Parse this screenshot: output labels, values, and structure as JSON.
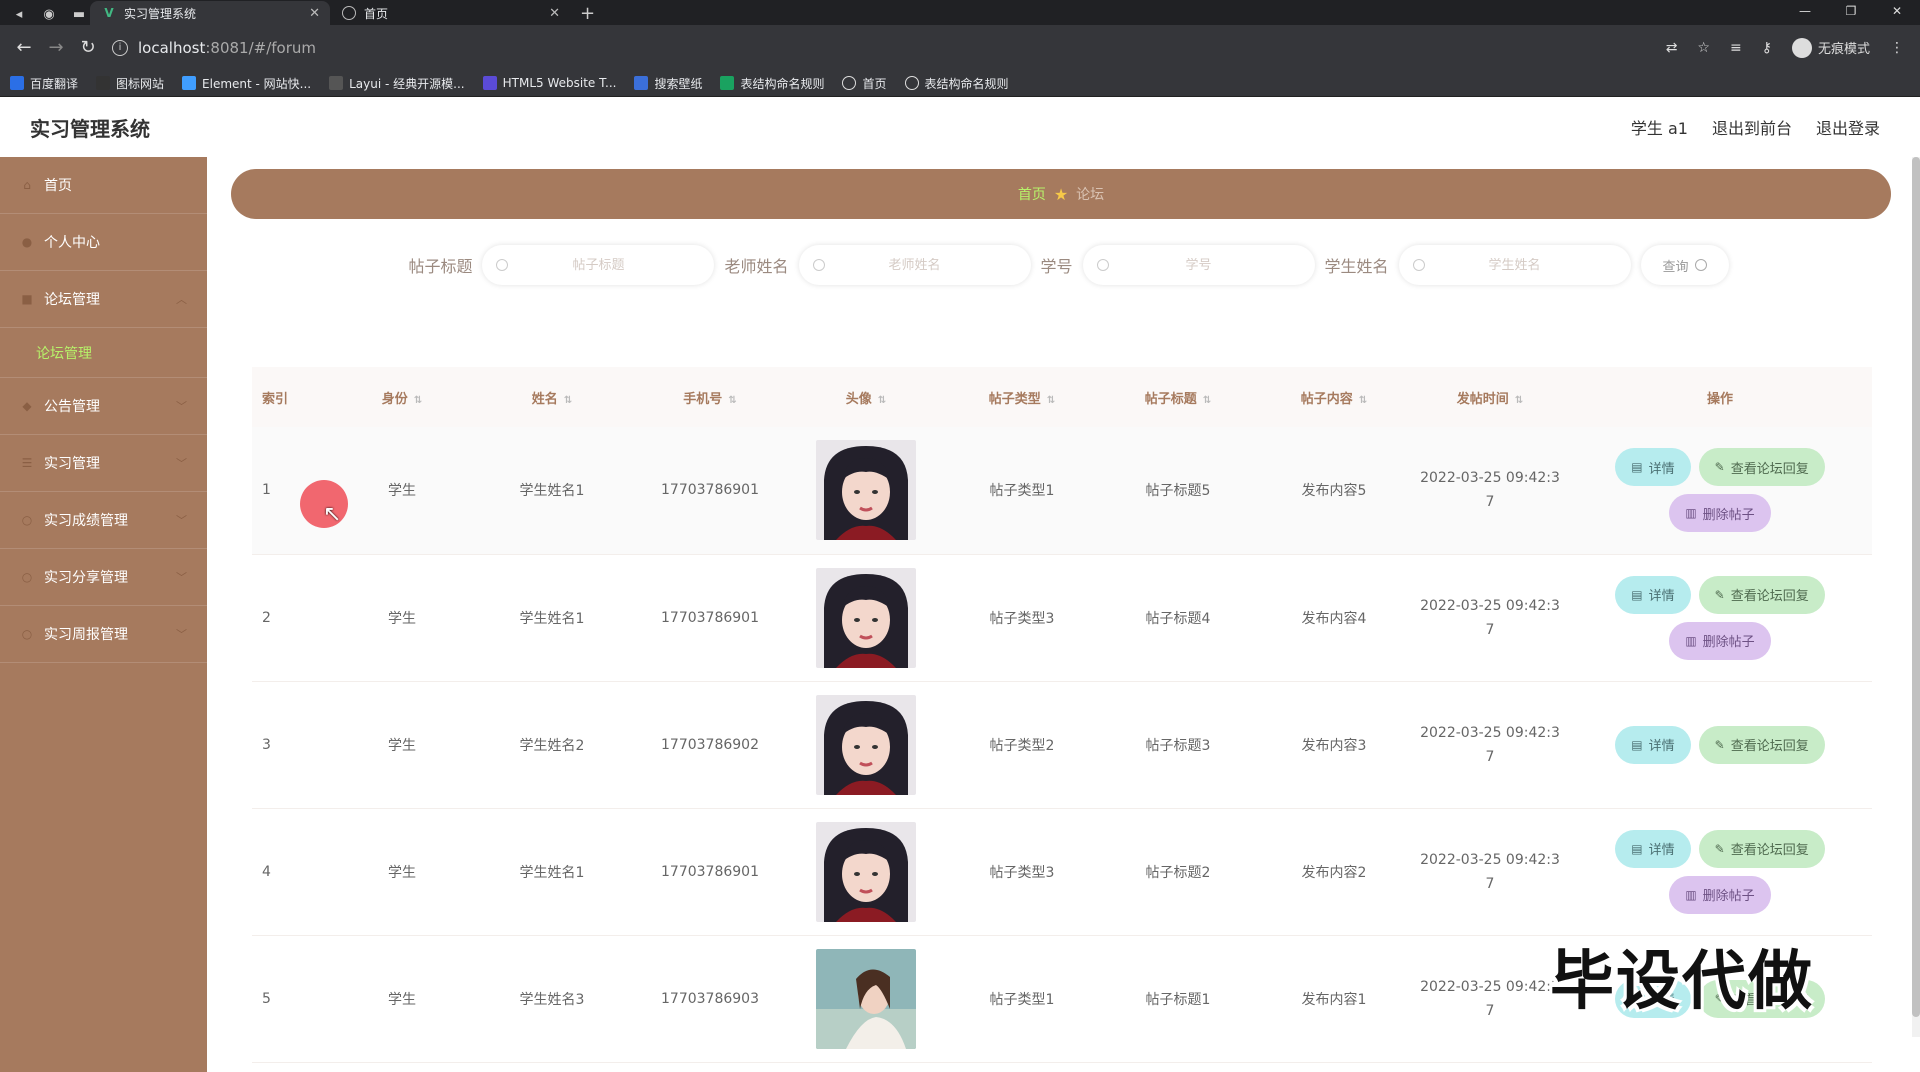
{
  "browser": {
    "tabs": [
      {
        "title": "实习管理系统",
        "active": true,
        "icon": "vue-icon"
      },
      {
        "title": "首页",
        "active": false,
        "icon": "globe-icon"
      }
    ],
    "url_host": "localhost",
    "url_path": ":8081/#/forum",
    "incognito_label": "无痕模式",
    "bookmarks": [
      {
        "label": "百度翻译",
        "icon": "baidu-translate-icon",
        "color": "#2b6fe6"
      },
      {
        "label": "图标网站",
        "icon": "flag-icon",
        "color": "#333333"
      },
      {
        "label": "Element - 网站快...",
        "icon": "element-icon",
        "color": "#409eff"
      },
      {
        "label": "Layui - 经典开源模...",
        "icon": "layui-icon",
        "color": "#555555"
      },
      {
        "label": "HTML5 Website T...",
        "icon": "html5-icon",
        "color": "#5b4bd6"
      },
      {
        "label": "搜索壁纸",
        "icon": "u-icon",
        "color": "#3b6fd9"
      },
      {
        "label": "表结构命名规则",
        "icon": "sheet-icon",
        "color": "#1aa260"
      },
      {
        "label": "首页",
        "icon": "globe-icon",
        "color": "#666666"
      },
      {
        "label": "表结构命名规则",
        "icon": "globe-icon",
        "color": "#666666"
      }
    ]
  },
  "header": {
    "title": "实习管理系统",
    "links": [
      "学生 a1",
      "退出到前台",
      "退出登录"
    ]
  },
  "sidebar": {
    "items": [
      {
        "label": "首页",
        "icon": "home-icon"
      },
      {
        "label": "个人中心",
        "icon": "user-icon"
      },
      {
        "label": "论坛管理",
        "icon": "forum-icon",
        "expanded": true,
        "children": [
          "论坛管理"
        ]
      },
      {
        "label": "公告管理",
        "icon": "notice-icon"
      },
      {
        "label": "实习管理",
        "icon": "internship-icon"
      },
      {
        "label": "实习成绩管理",
        "icon": "score-icon"
      },
      {
        "label": "实习分享管理",
        "icon": "share-icon"
      },
      {
        "label": "实习周报管理",
        "icon": "report-icon"
      }
    ]
  },
  "breadcrumb": {
    "home": "首页",
    "current": "论坛"
  },
  "search": {
    "fields": [
      {
        "label": "帖子标题",
        "placeholder": "帖子标题"
      },
      {
        "label": "老师姓名",
        "placeholder": "老师姓名"
      },
      {
        "label": "学号",
        "placeholder": "学号"
      },
      {
        "label": "学生姓名",
        "placeholder": "学生姓名"
      }
    ],
    "button": "查询"
  },
  "table": {
    "columns": [
      "索引",
      "身份",
      "姓名",
      "手机号",
      "头像",
      "帖子类型",
      "帖子标题",
      "帖子内容",
      "发帖时间",
      "操作"
    ],
    "rows": [
      {
        "index": "1",
        "role": "学生",
        "name": "学生姓名1",
        "phone": "17703786901",
        "avatar": "girl-portrait-1",
        "type": "帖子类型1",
        "title": "帖子标题5",
        "content": "发布内容5",
        "time": "2022-03-25 09:42:3",
        "time2": "7"
      },
      {
        "index": "2",
        "role": "学生",
        "name": "学生姓名1",
        "phone": "17703786901",
        "avatar": "girl-portrait-1",
        "type": "帖子类型3",
        "title": "帖子标题4",
        "content": "发布内容4",
        "time": "2022-03-25 09:42:3",
        "time2": "7"
      },
      {
        "index": "3",
        "role": "学生",
        "name": "学生姓名2",
        "phone": "17703786902",
        "avatar": "girl-portrait-1",
        "type": "帖子类型2",
        "title": "帖子标题3",
        "content": "发布内容3",
        "time": "2022-03-25 09:42:3",
        "time2": "7"
      },
      {
        "index": "4",
        "role": "学生",
        "name": "学生姓名1",
        "phone": "17703786901",
        "avatar": "girl-portrait-1",
        "type": "帖子类型3",
        "title": "帖子标题2",
        "content": "发布内容2",
        "time": "2022-03-25 09:42:3",
        "time2": "7"
      },
      {
        "index": "5",
        "role": "学生",
        "name": "学生姓名3",
        "phone": "17703786903",
        "avatar": "girl-portrait-2",
        "type": "帖子类型1",
        "title": "帖子标题1",
        "content": "发布内容1",
        "time": "2022-03-25 09:42:3",
        "time2": "7"
      }
    ],
    "actions": {
      "detail": "详情",
      "reply": "查看论坛回复",
      "delete": "删除帖子"
    }
  },
  "watermark": "毕设代做",
  "colors": {
    "primary": "#a67a5e",
    "active_menu": "#b7f26a",
    "detail_btn": "#b6ecee",
    "reply_btn": "#c8ecc8",
    "delete_btn": "#dcc4ef"
  }
}
